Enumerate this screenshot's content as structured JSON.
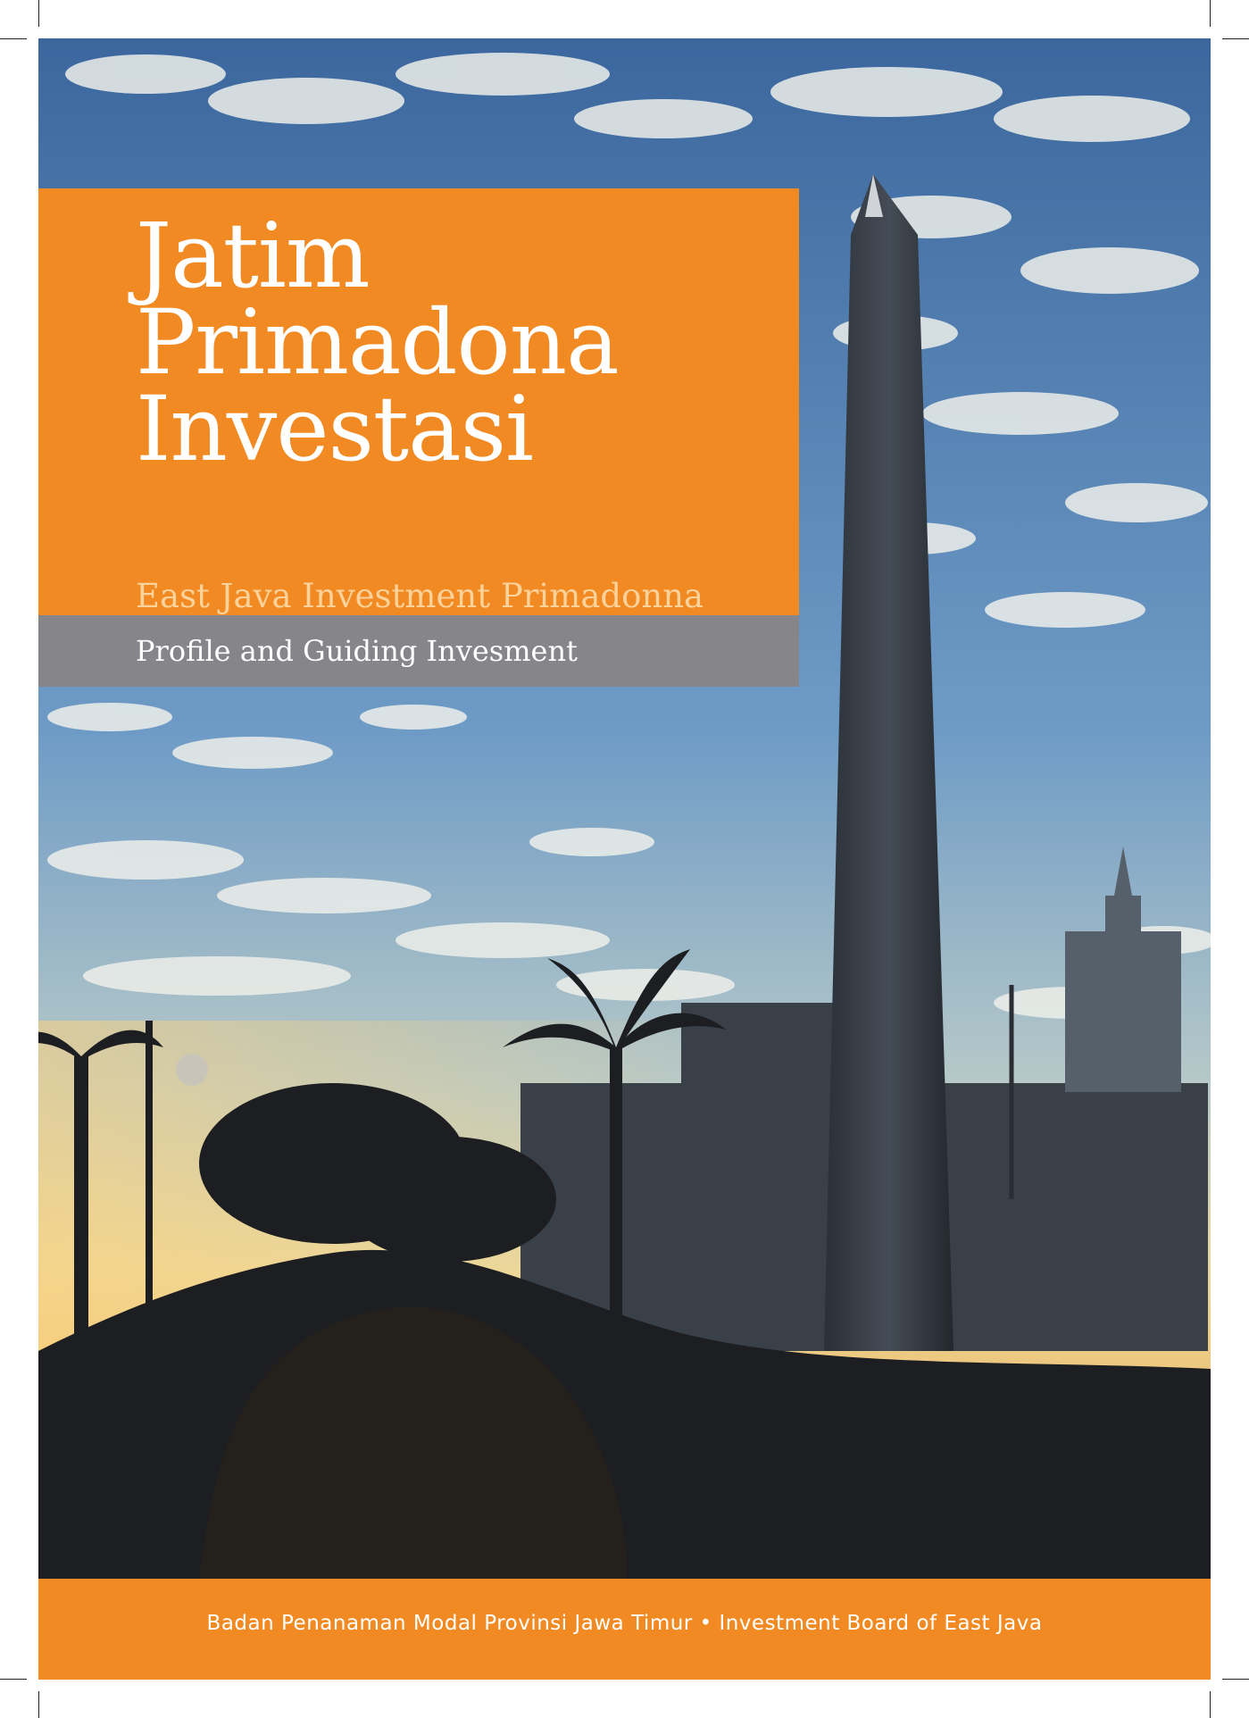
{
  "cover": {
    "title_lines": [
      "Jatim",
      "Primadona",
      "Investasi"
    ],
    "subtitle": "East Java Investment Primadonna",
    "guide": "Profile and Guiding Invesment",
    "footer": "Badan Penanaman Modal Provinsi Jawa Timur • Investment Board of East Java"
  },
  "colors": {
    "accent_orange": "#F28A23",
    "subtitle_text": "#FBD29A",
    "guide_band": "#85858A",
    "sky_top": "#3F6FA6",
    "sky_bottom": "#F2C46E",
    "silhouette": "#1E2024"
  }
}
